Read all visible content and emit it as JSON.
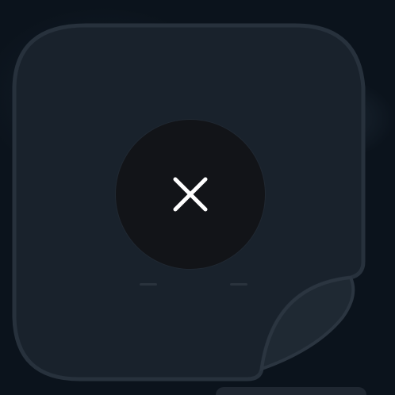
{
  "widget": {
    "icon": "close-icon",
    "tile_color": "#1a232d",
    "tile_border_color": "#28323d",
    "button_color": "#121418",
    "icon_color": "#ffffff"
  }
}
